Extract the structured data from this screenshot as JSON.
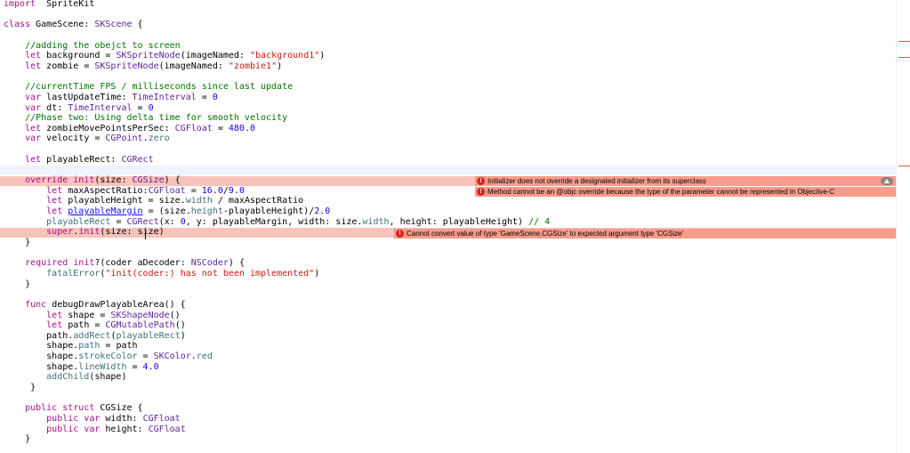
{
  "editor": {
    "lines": [
      {
        "spans": [
          [
            "kw",
            "import"
          ],
          [
            "",
            "  SpriteKit"
          ]
        ]
      },
      {
        "spans": []
      },
      {
        "spans": [
          [
            "kw",
            "class"
          ],
          [
            "",
            " GameScene: "
          ],
          [
            "ty",
            "SKScene"
          ],
          [
            "",
            " {"
          ]
        ]
      },
      {
        "spans": []
      },
      {
        "spans": [
          [
            "cm",
            "    //adding the obejct to screen"
          ]
        ]
      },
      {
        "spans": [
          [
            "kw",
            "    let"
          ],
          [
            "",
            " background = "
          ],
          [
            "ty",
            "SKSpriteNode"
          ],
          [
            "",
            "(imageNamed: "
          ],
          [
            "str",
            "\"background1\""
          ],
          [
            "",
            ")"
          ]
        ]
      },
      {
        "spans": [
          [
            "kw",
            "    let"
          ],
          [
            "",
            " zombie = "
          ],
          [
            "ty",
            "SKSpriteNode"
          ],
          [
            "",
            "(imageNamed: "
          ],
          [
            "str",
            "\"zombie1\""
          ],
          [
            "",
            ")"
          ]
        ]
      },
      {
        "spans": []
      },
      {
        "spans": [
          [
            "cm",
            "    //currentTime FPS / milliseconds since last update"
          ]
        ]
      },
      {
        "spans": [
          [
            "kw",
            "    var"
          ],
          [
            "",
            " lastUpdateTime: "
          ],
          [
            "ty",
            "TimeInterval"
          ],
          [
            "",
            " = "
          ],
          [
            "num",
            "0"
          ]
        ]
      },
      {
        "spans": [
          [
            "kw",
            "    var"
          ],
          [
            "",
            " dt: "
          ],
          [
            "ty",
            "TimeInterval"
          ],
          [
            "",
            " = "
          ],
          [
            "num",
            "0"
          ]
        ]
      },
      {
        "spans": [
          [
            "cm",
            "    //Phase two: Using delta time for smooth velocity"
          ]
        ]
      },
      {
        "spans": [
          [
            "kw",
            "    let"
          ],
          [
            "",
            " zombieMovePointsPerSec: "
          ],
          [
            "ty",
            "CGFloat"
          ],
          [
            "",
            " = "
          ],
          [
            "num",
            "480.0"
          ]
        ]
      },
      {
        "spans": [
          [
            "kw",
            "    var"
          ],
          [
            "",
            " velocity = "
          ],
          [
            "ty",
            "CGPoint"
          ],
          [
            "",
            "."
          ],
          [
            "pt",
            "zero"
          ]
        ]
      },
      {
        "spans": []
      },
      {
        "spans": [
          [
            "kw",
            "    let"
          ],
          [
            "",
            " playableRect: "
          ],
          [
            "ty",
            "CGRect"
          ]
        ]
      },
      {
        "spans": []
      },
      {
        "spans": [
          [
            "kw",
            "    override"
          ],
          [
            "",
            " "
          ],
          [
            "kw",
            "init"
          ],
          [
            "",
            "(size: "
          ],
          [
            "ty",
            "CGSize"
          ],
          [
            "",
            ") {"
          ]
        ]
      },
      {
        "spans": [
          [
            "kw",
            "        let"
          ],
          [
            "",
            " maxAspectRatio:"
          ],
          [
            "ty",
            "CGFloat"
          ],
          [
            "",
            " = "
          ],
          [
            "num",
            "16.0"
          ],
          [
            "",
            "/"
          ],
          [
            "num",
            "9.0"
          ]
        ]
      },
      {
        "spans": [
          [
            "kw",
            "        let"
          ],
          [
            "",
            " playableHeight = size."
          ],
          [
            "pt",
            "width"
          ],
          [
            "",
            " / maxAspectRatio"
          ]
        ]
      },
      {
        "spans": [
          [
            "kw",
            "        let"
          ],
          [
            "",
            " "
          ],
          [
            "lk",
            "playableMargin"
          ],
          [
            "",
            " = (size."
          ],
          [
            "pt",
            "height"
          ],
          [
            "",
            "-playableHeight)/"
          ],
          [
            "num",
            "2.0"
          ]
        ]
      },
      {
        "spans": [
          [
            "pt",
            "        playableRect"
          ],
          [
            "",
            " = "
          ],
          [
            "ty",
            "CGRect"
          ],
          [
            "",
            "(x: "
          ],
          [
            "num",
            "0"
          ],
          [
            "",
            ", y: playableMargin, width: size."
          ],
          [
            "pt",
            "width"
          ],
          [
            "",
            ", height: playableHeight) "
          ],
          [
            "cm",
            "// 4"
          ]
        ]
      },
      {
        "spans": [
          [
            "kw",
            "        super"
          ],
          [
            "",
            "."
          ],
          [
            "kw",
            "init"
          ],
          [
            "",
            "(size: size)"
          ]
        ]
      },
      {
        "spans": [
          [
            "",
            "    }"
          ]
        ]
      },
      {
        "spans": []
      },
      {
        "spans": [
          [
            "kw",
            "    required"
          ],
          [
            "",
            " "
          ],
          [
            "kw",
            "init"
          ],
          [
            "",
            "?(coder aDecoder: "
          ],
          [
            "ty",
            "NSCoder"
          ],
          [
            "",
            ") {"
          ]
        ]
      },
      {
        "spans": [
          [
            "pt",
            "        fatalError"
          ],
          [
            "",
            "("
          ],
          [
            "str",
            "\"init(coder:) has not been implemented\""
          ],
          [
            "",
            ")"
          ]
        ]
      },
      {
        "spans": [
          [
            "",
            "    }"
          ]
        ]
      },
      {
        "spans": []
      },
      {
        "spans": [
          [
            "kw",
            "    func"
          ],
          [
            "",
            " debugDrawPlayableArea() {"
          ]
        ]
      },
      {
        "spans": [
          [
            "kw",
            "        let"
          ],
          [
            "",
            " shape = "
          ],
          [
            "ty",
            "SKShapeNode"
          ],
          [
            "",
            "()"
          ]
        ]
      },
      {
        "spans": [
          [
            "kw",
            "        let"
          ],
          [
            "",
            " path = "
          ],
          [
            "ty",
            "CGMutablePath"
          ],
          [
            "",
            "()"
          ]
        ]
      },
      {
        "spans": [
          [
            "",
            "        path."
          ],
          [
            "pt",
            "addRect"
          ],
          [
            "",
            "("
          ],
          [
            "pt",
            "playableRect"
          ],
          [
            "",
            ")"
          ]
        ]
      },
      {
        "spans": [
          [
            "",
            "        shape."
          ],
          [
            "pt",
            "path"
          ],
          [
            "",
            " = path"
          ]
        ]
      },
      {
        "spans": [
          [
            "",
            "        shape."
          ],
          [
            "pt",
            "strokeColor"
          ],
          [
            "",
            " = "
          ],
          [
            "ty",
            "SKColor"
          ],
          [
            "",
            "."
          ],
          [
            "pt",
            "red"
          ]
        ]
      },
      {
        "spans": [
          [
            "",
            "        shape."
          ],
          [
            "pt",
            "lineWidth"
          ],
          [
            "",
            " = "
          ],
          [
            "num",
            "4.0"
          ]
        ]
      },
      {
        "spans": [
          [
            "pt",
            "        addChild"
          ],
          [
            "",
            "(shape)"
          ]
        ]
      },
      {
        "spans": [
          [
            "",
            "     }"
          ]
        ]
      },
      {
        "spans": []
      },
      {
        "spans": [
          [
            "kw",
            "    public"
          ],
          [
            "",
            " "
          ],
          [
            "kw",
            "struct"
          ],
          [
            "",
            " CGSize {"
          ]
        ]
      },
      {
        "spans": [
          [
            "kw",
            "        public"
          ],
          [
            "",
            " "
          ],
          [
            "kw",
            "var"
          ],
          [
            "",
            " width: "
          ],
          [
            "ty",
            "CGFloat"
          ]
        ]
      },
      {
        "spans": [
          [
            "kw",
            "        public"
          ],
          [
            "",
            " "
          ],
          [
            "kw",
            "var"
          ],
          [
            "",
            " height: "
          ],
          [
            "ty",
            "CGFloat"
          ]
        ]
      },
      {
        "spans": [
          [
            "",
            "    }"
          ]
        ]
      }
    ]
  },
  "errors": {
    "e1": "Initializer does not override a designated initializer from its superclass",
    "e2": "Method cannot be an @objc override because the type of the parameter cannot be represented in Objective-C",
    "e3": "Cannot convert value of type 'GameScene.CGSize' to expected argument type 'CGSize'",
    "icon_glyph": "!"
  },
  "colors": {
    "error_line": "#f7c3ba",
    "error_bubble": "#f79b8b",
    "error_icon": "#e0201c"
  }
}
